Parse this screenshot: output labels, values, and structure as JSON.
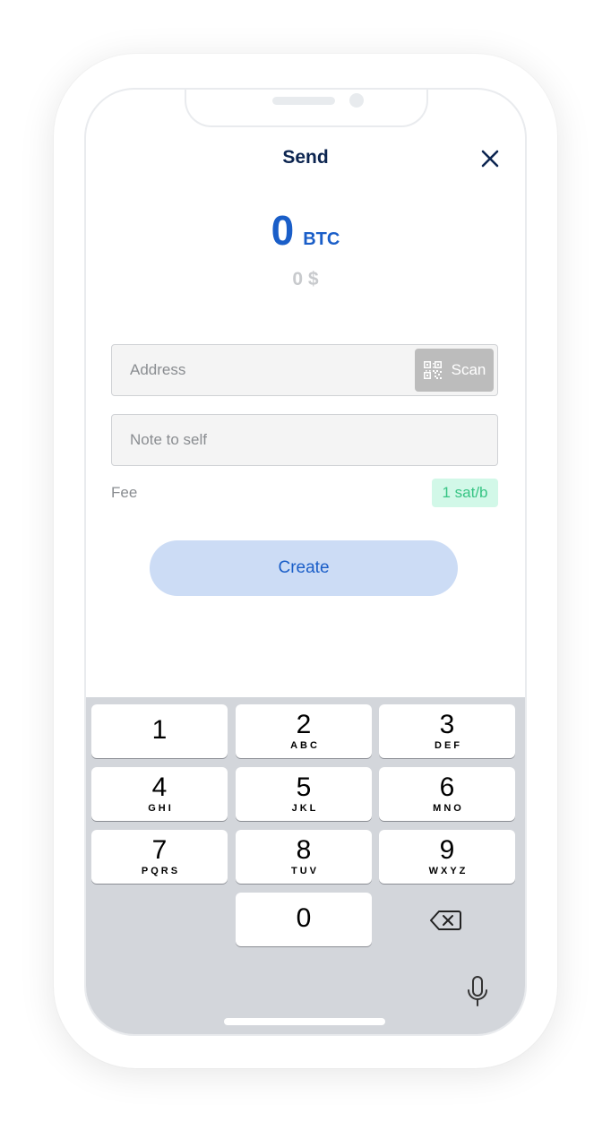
{
  "header": {
    "title": "Send",
    "close_icon": "close-icon"
  },
  "amount": {
    "value": "0",
    "unit": "BTC",
    "fiat": "0 $"
  },
  "address": {
    "placeholder": "Address",
    "value": "",
    "scan_label": "Scan",
    "scan_icon": "qr-code-icon"
  },
  "note": {
    "placeholder": "Note to self",
    "value": ""
  },
  "fee": {
    "label": "Fee",
    "value": "1 sat/b"
  },
  "create": {
    "label": "Create"
  },
  "keyboard": {
    "keys": [
      {
        "digit": "1",
        "letters": ""
      },
      {
        "digit": "2",
        "letters": "ABC"
      },
      {
        "digit": "3",
        "letters": "DEF"
      },
      {
        "digit": "4",
        "letters": "GHI"
      },
      {
        "digit": "5",
        "letters": "JKL"
      },
      {
        "digit": "6",
        "letters": "MNO"
      },
      {
        "digit": "7",
        "letters": "PQRS"
      },
      {
        "digit": "8",
        "letters": "TUV"
      },
      {
        "digit": "9",
        "letters": "WXYZ"
      },
      {
        "digit": "0",
        "letters": ""
      }
    ],
    "backspace_icon": "backspace-icon",
    "mic_icon": "microphone-icon"
  },
  "colors": {
    "accent": "#1a5ec8",
    "title": "#0c2550",
    "fee_badge_bg": "#d2f8e8",
    "fee_badge_text": "#37c484",
    "create_bg": "#ccdcf5",
    "keyboard_bg": "#d3d6db"
  }
}
